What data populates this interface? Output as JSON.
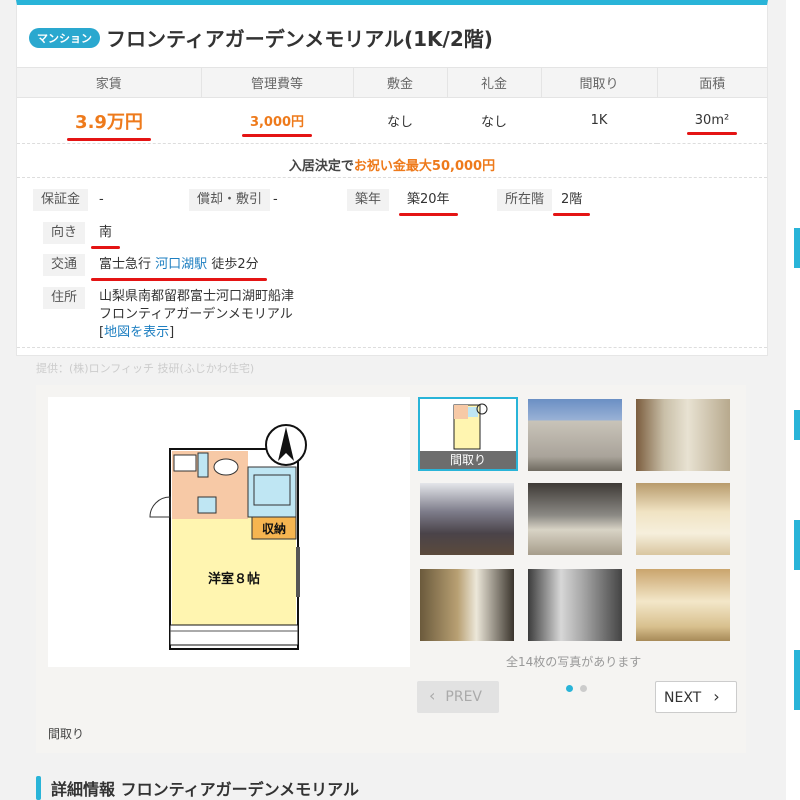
{
  "header": {
    "badge": "マンション",
    "title": "フロンティアガーデンメモリアル(1K/2階)"
  },
  "price_table": {
    "headers": [
      "家賃",
      "管理費等",
      "敷金",
      "礼金",
      "間取り",
      "面積"
    ],
    "values": {
      "rent": "3.9万円",
      "management_fee": "3,000円",
      "deposit": "なし",
      "key_money": "なし",
      "layout": "1K",
      "area": "30m²"
    }
  },
  "promo": {
    "prefix": "入居決定で",
    "highlight": "お祝い金最大50,000円"
  },
  "details": {
    "guarantee_label": "保証金",
    "guarantee_value": "-",
    "depreciation_label": "償却・敷引",
    "depreciation_value": "-",
    "age_label": "築年",
    "age_value": "築20年",
    "floor_label": "所在階",
    "floor_value": "2階",
    "direction_label": "向き",
    "direction_value": "南",
    "transport_label": "交通",
    "transport_line": "富士急行",
    "transport_station": "河口湖駅",
    "transport_walk": "徒歩2分",
    "address_label": "住所",
    "address_line1": "山梨県南都留郡富士河口湖町船津",
    "address_line2": "フロンティアガーデンメモリアル",
    "map_open": "[",
    "map_link": "地図を表示",
    "map_close": "]"
  },
  "faint_text": "提供：(株)ロンフィッチ 技研(ふじかわ住宅)",
  "gallery": {
    "floorplan_labels": {
      "room": "洋室８帖",
      "storage": "収納"
    },
    "main_caption": "間取り",
    "selected_thumb_caption": "間取り",
    "photo_count": "全14枚の写真があります",
    "prev_label": "PREV",
    "next_label": "NEXT"
  },
  "section": {
    "title": "詳細情報 フロンティアガーデンメモリアル"
  },
  "colors": {
    "accent": "#29b4d8",
    "price": "#ee7a1b",
    "underline": "#e41414",
    "link": "#1e7fc1"
  }
}
